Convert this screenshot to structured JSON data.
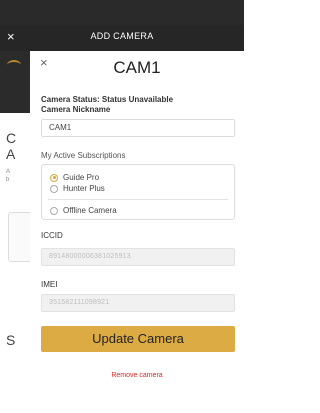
{
  "header": {
    "title": "ADD CAMERA",
    "close_glyph": "×"
  },
  "background": {
    "text_c": "C",
    "text_a": "A",
    "small_text": "A\nb",
    "text_s": "S"
  },
  "modal": {
    "close_glyph": "×",
    "title": "CAM1",
    "status_text": "Camera Status: Status Unavailable",
    "nickname_label": "Camera Nickname",
    "nickname_value": "CAM1",
    "subscriptions_label": "My Active Subscriptions",
    "subscriptions": [
      {
        "label": "Guide Pro",
        "selected": true
      },
      {
        "label": "Hunter Plus",
        "selected": false
      },
      {
        "label": "Offline Camera",
        "selected": false
      }
    ],
    "iccid_label": "ICCID",
    "iccid_value": "89148000006381025913",
    "imei_label": "IMEI",
    "imei_value": "351582111098921",
    "update_button": "Update Camera",
    "remove_link": "Remove camera"
  },
  "colors": {
    "accent": "#dcab44",
    "danger": "#d62828",
    "header_bg": "#262626",
    "overlay": "#5c5c5c"
  }
}
